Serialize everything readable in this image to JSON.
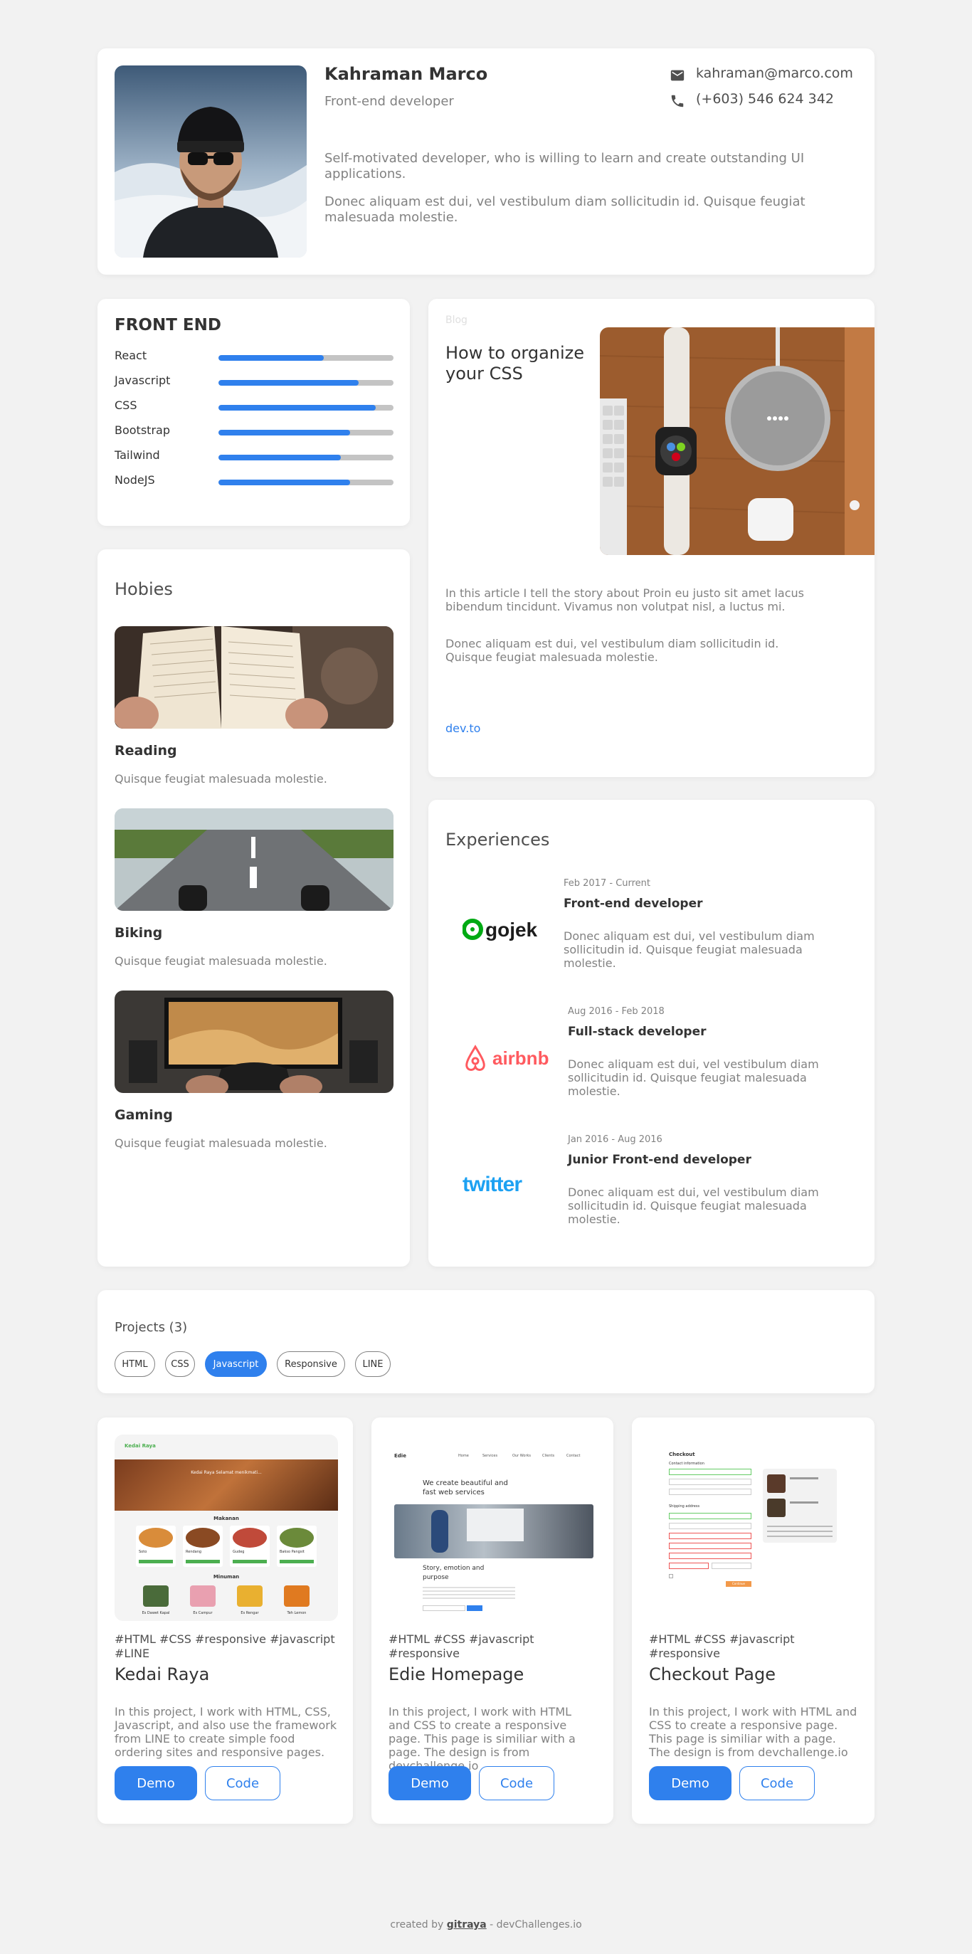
{
  "profile": {
    "name": "Kahraman Marco",
    "role": "Front-end developer",
    "email": "kahraman@marco.com",
    "phone": "(+603) 546 624 342",
    "bio1": "Self-motivated developer, who is willing to learn and create outstanding UI applications.",
    "bio2": "Donec aliquam est dui, vel vestibulum diam sollicitudin id. Quisque feugiat malesuada molestie."
  },
  "skills": {
    "title": "FRONT END",
    "items": [
      {
        "label": "React",
        "level": 0.6
      },
      {
        "label": "Javascript",
        "level": 0.8
      },
      {
        "label": "CSS",
        "level": 0.9
      },
      {
        "label": "Bootstrap",
        "level": 0.75
      },
      {
        "label": "Tailwind",
        "level": 0.7
      },
      {
        "label": "NodeJS",
        "level": 0.75
      }
    ]
  },
  "blog": {
    "label": "Blog",
    "title": "How to organize your CSS",
    "p1": "In this article I tell the story about Proin eu justo sit amet lacus bibendum tincidunt. Vivamus non volutpat nisl, a luctus mi.",
    "p2": "Donec aliquam est dui, vel vestibulum diam sollicitudin id. Quisque feugiat malesuada molestie.",
    "link": "dev.to"
  },
  "hobbies": {
    "title": "Hobies",
    "items": [
      {
        "name": "Reading",
        "desc": "Quisque feugiat malesuada molestie."
      },
      {
        "name": "Biking",
        "desc": "Quisque feugiat malesuada molestie."
      },
      {
        "name": "Gaming",
        "desc": "Quisque feugiat malesuada molestie."
      }
    ]
  },
  "experiences": {
    "title": "Experiences",
    "items": [
      {
        "logo": "gojek",
        "date": "Feb 2017 - Current",
        "title": "Front-end developer",
        "desc": "Donec aliquam est dui, vel vestibulum diam sollicitudin id. Quisque feugiat malesuada molestie."
      },
      {
        "logo": "airbnb",
        "date": "Aug 2016 - Feb 2018",
        "title": "Full-stack developer",
        "desc": "Donec aliquam est dui, vel vestibulum diam sollicitudin id. Quisque feugiat malesuada molestie."
      },
      {
        "logo": "twitter",
        "date": "Jan 2016 - Aug 2016",
        "title": "Junior Front-end developer",
        "desc": "Donec aliquam est dui, vel vestibulum diam sollicitudin id. Quisque feugiat malesuada molestie."
      }
    ]
  },
  "projects": {
    "heading": "Projects (3)",
    "filters": [
      {
        "label": "HTML",
        "active": false
      },
      {
        "label": "CSS",
        "active": false
      },
      {
        "label": "Javascript",
        "active": true
      },
      {
        "label": "Responsive",
        "active": false
      },
      {
        "label": "LINE",
        "active": false
      }
    ],
    "items": [
      {
        "tags": "#HTML  #CSS  #responsive #javascript  #LINE",
        "title": "Kedai Raya",
        "desc": "In this project, I work with HTML, CSS, Javascript, and also use the framework from LINE to create simple food ordering sites and responsive pages.",
        "demo": "Demo",
        "code": "Code",
        "thumb": {
          "brand": "Kedai Raya",
          "banner": "Kedai Raya Selamat menikmati...",
          "section1": "Makanan",
          "section2": "Minuman",
          "foods": [
            "Soto",
            "Rendang",
            "Gudeg",
            "Bakso Pangsit"
          ],
          "drinks": [
            "Es Dawet Kapal",
            "Es Campur",
            "Es Rengar",
            "Teh Lemon"
          ]
        }
      },
      {
        "tags": "#HTML  #CSS  #javascript #responsive",
        "title": "Edie Homepage",
        "desc": "In this project, I work with HTML and CSS to create a responsive page. This page is similiar with a page. The design is from devchallenge.io",
        "demo": "Demo",
        "code": "Code",
        "thumb": {
          "brand": "Edie",
          "nav": [
            "Home",
            "Services",
            "Our Works",
            "Clients",
            "Contact"
          ],
          "headline": "We create beautiful and fast web services",
          "sub": "Story, emotion and purpose"
        }
      },
      {
        "tags": "#HTML  #CSS  #javascript #responsive",
        "title": "Checkout Page",
        "desc": "In this project, I work with HTML and CSS to create a responsive page. This page is similiar with a page. The design is from devchallenge.io",
        "demo": "Demo",
        "code": "Code",
        "thumb": {
          "heading": "Checkout",
          "section1": "Contact information",
          "section2": "Shipping address",
          "button": "Continue"
        }
      }
    ]
  },
  "footer": {
    "prefix": "created by ",
    "author": "gitraya",
    "suffix": " - devChallenges.io"
  },
  "colors": {
    "accent": "#2f80ed",
    "background": "#f2f2f2",
    "gojek": "#00aa13",
    "airbnb": "#ff5a5f",
    "twitter": "#1da1f2"
  }
}
